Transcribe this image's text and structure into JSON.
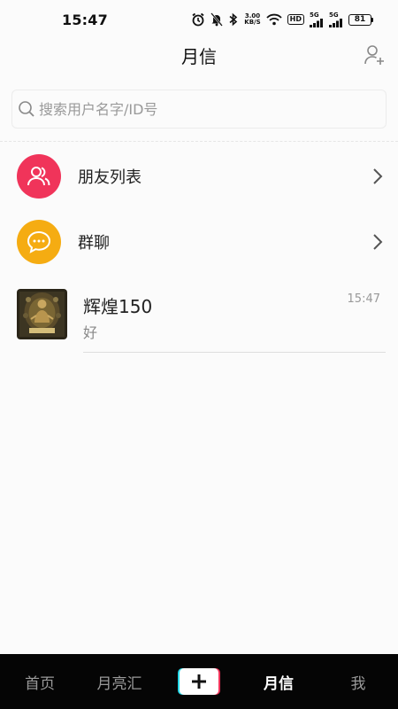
{
  "status_bar": {
    "time": "15:47",
    "net_speed_value": "3.00",
    "net_speed_unit": "KB/S",
    "hd": "HD",
    "signal1": "5G",
    "signal2": "5G",
    "battery": "81"
  },
  "header": {
    "title": "月信",
    "add_friend_icon": "add-user-icon"
  },
  "search": {
    "placeholder": "搜索用户名字/ID号"
  },
  "rows": [
    {
      "label": "朋友列表",
      "icon": "users-icon",
      "color": "#f0345a"
    },
    {
      "label": "群聊",
      "icon": "chat-bubble-icon",
      "color": "#f5ac12"
    }
  ],
  "chat": {
    "name": "辉煌150",
    "time": "15:47",
    "preview": "好"
  },
  "bottom_nav": {
    "items": [
      "首页",
      "月亮汇",
      "月信",
      "我"
    ],
    "active": "月信",
    "plus_icon": "plus-icon"
  }
}
